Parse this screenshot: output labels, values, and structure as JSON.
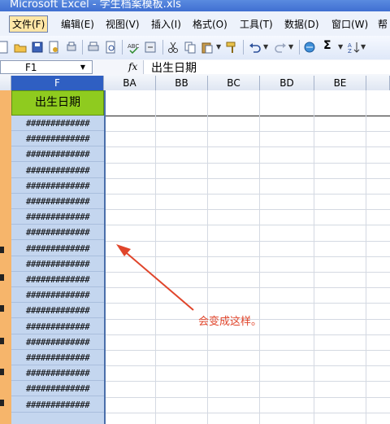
{
  "window": {
    "title": "Microsoft Excel - 学生档案模板.xls"
  },
  "menu": {
    "items": [
      {
        "label": "文件(F)",
        "active": true
      },
      {
        "label": "编辑(E)"
      },
      {
        "label": "视图(V)"
      },
      {
        "label": "插入(I)"
      },
      {
        "label": "格式(O)"
      },
      {
        "label": "工具(T)"
      },
      {
        "label": "数据(D)"
      },
      {
        "label": "窗口(W)"
      },
      {
        "label": "帮"
      }
    ]
  },
  "toolbar": {
    "icons": [
      "new-icon",
      "open-icon",
      "save-icon",
      "permission-icon",
      "print-preview-icon",
      "print-icon",
      "spelling-icon",
      "research-icon",
      "cut-icon",
      "copy-icon",
      "paste-icon",
      "format-painter-icon",
      "undo-icon",
      "redo-icon",
      "hyperlink-icon",
      "autosum-icon",
      "sort-ascending-icon"
    ],
    "sum_symbol": "Σ"
  },
  "formula_bar": {
    "name_box": "F1",
    "fx_label": "fx",
    "content": "出生日期"
  },
  "columns": [
    {
      "label": "F",
      "selected": true
    },
    {
      "label": "BA"
    },
    {
      "label": "BB"
    },
    {
      "label": "BC"
    },
    {
      "label": "BD"
    },
    {
      "label": "BE"
    }
  ],
  "sheet": {
    "header_cell": "出生日期",
    "overflow_text": "#############",
    "overflow_rows": 19
  },
  "annotation": {
    "text": "会变成这样。",
    "color": "#e0452b"
  },
  "colors": {
    "header_fill": "#8fcb1f",
    "selected_column": "#c4d6ef",
    "column_header_selected": "#2f5fc2"
  }
}
